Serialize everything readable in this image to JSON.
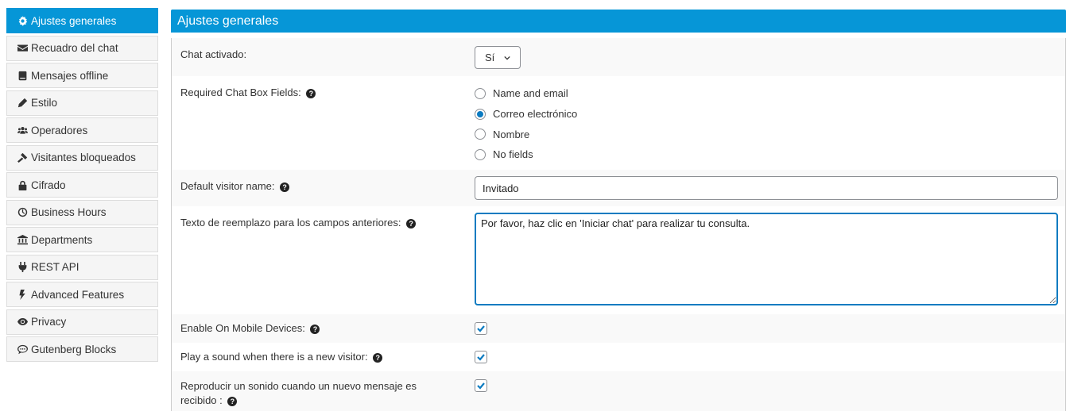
{
  "sidebar": {
    "items": [
      {
        "label": "Ajustes generales",
        "icon": "gear-icon",
        "active": true
      },
      {
        "label": "Recuadro del chat",
        "icon": "envelope-icon"
      },
      {
        "label": "Mensajes offline",
        "icon": "book-icon"
      },
      {
        "label": "Estilo",
        "icon": "pencil-icon"
      },
      {
        "label": "Operadores",
        "icon": "users-icon"
      },
      {
        "label": "Visitantes bloqueados",
        "icon": "gavel-icon"
      },
      {
        "label": "Cifrado",
        "icon": "lock-icon"
      },
      {
        "label": "Business Hours",
        "icon": "clock-icon"
      },
      {
        "label": "Departments",
        "icon": "bank-icon"
      },
      {
        "label": "REST API",
        "icon": "plug-icon"
      },
      {
        "label": "Advanced Features",
        "icon": "bolt-icon"
      },
      {
        "label": "Privacy",
        "icon": "eye-icon"
      },
      {
        "label": "Gutenberg Blocks",
        "icon": "comment-icon"
      }
    ]
  },
  "panel": {
    "title": "Ajustes generales",
    "chat_enabled": {
      "label": "Chat activado:",
      "value": "Sí"
    },
    "required_fields": {
      "label": "Required Chat Box Fields:",
      "options": [
        "Name and email",
        "Correo electrónico",
        "Nombre",
        "No fields"
      ],
      "selected": "Correo electrónico"
    },
    "default_visitor_name": {
      "label": "Default visitor name:",
      "value": "Invitado"
    },
    "replacement_text": {
      "label": "Texto de reemplazo para los campos anteriores:",
      "value": "Por favor, haz clic en 'Iniciar chat' para realizar tu consulta."
    },
    "mobile": {
      "label": "Enable On Mobile Devices:",
      "checked": true
    },
    "sound_visitor": {
      "label": "Play a sound when there is a new visitor:",
      "checked": true
    },
    "sound_message": {
      "label": "Reproducir un sonido cuando un nuevo mensaje es recibido :",
      "checked": true
    }
  },
  "help_glyph": "?",
  "colors": {
    "accent": "#0696d7",
    "check": "#0b7bc1"
  }
}
